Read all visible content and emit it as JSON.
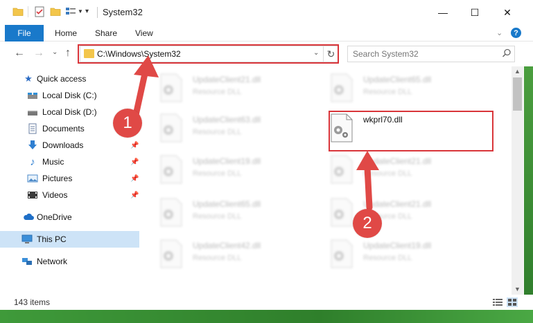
{
  "window": {
    "title": "System32",
    "minimize": "—",
    "maximize": "☐",
    "close": "✕"
  },
  "ribbon": {
    "file": "File",
    "home": "Home",
    "share": "Share",
    "view": "View",
    "help": "?"
  },
  "address": {
    "path": "C:\\Windows\\System32",
    "search_placeholder": "Search System32"
  },
  "sidebar": {
    "items": [
      {
        "label": "Quick access",
        "icon": "star-icon"
      },
      {
        "label": "Local Disk (C:)",
        "icon": "drive-icon"
      },
      {
        "label": "Local Disk (D:)",
        "icon": "drive-icon"
      },
      {
        "label": "Documents",
        "icon": "documents-icon"
      },
      {
        "label": "Downloads",
        "icon": "download-icon"
      },
      {
        "label": "Music",
        "icon": "music-icon"
      },
      {
        "label": "Pictures",
        "icon": "pictures-icon"
      },
      {
        "label": "Videos",
        "icon": "videos-icon"
      },
      {
        "label": "OneDrive",
        "icon": "cloud-icon"
      },
      {
        "label": "This PC",
        "icon": "computer-icon"
      },
      {
        "label": "Network",
        "icon": "network-icon"
      }
    ]
  },
  "files": {
    "left": [
      {
        "name": "UpdateClient21.dll",
        "type": "Resource DLL"
      },
      {
        "name": "UpdateClient63.dll",
        "type": "Resource DLL"
      },
      {
        "name": "UpdateClient19.dll",
        "type": "Resource DLL"
      },
      {
        "name": "UpdateClient65.dll",
        "type": "Resource DLL"
      },
      {
        "name": "UpdateClient42.dll",
        "type": "Resource DLL"
      }
    ],
    "right": [
      {
        "name": "UpdateClient65.dll",
        "type": "Resource DLL"
      },
      {
        "name": "wkprl70.dll",
        "type": ""
      },
      {
        "name": "UpdateClient21.dll",
        "type": "Resource DLL"
      },
      {
        "name": "UpdateClient21.dll",
        "type": "Resource DLL"
      },
      {
        "name": "UpdateClient19.dll",
        "type": "Resource DLL"
      }
    ]
  },
  "status": {
    "count": "143 items"
  },
  "annotations": {
    "step1": "1",
    "step2": "2",
    "color": "#e04946"
  },
  "colors": {
    "accent": "#1979ca",
    "highlight": "#d9353a",
    "selected": "#cde3f7"
  }
}
